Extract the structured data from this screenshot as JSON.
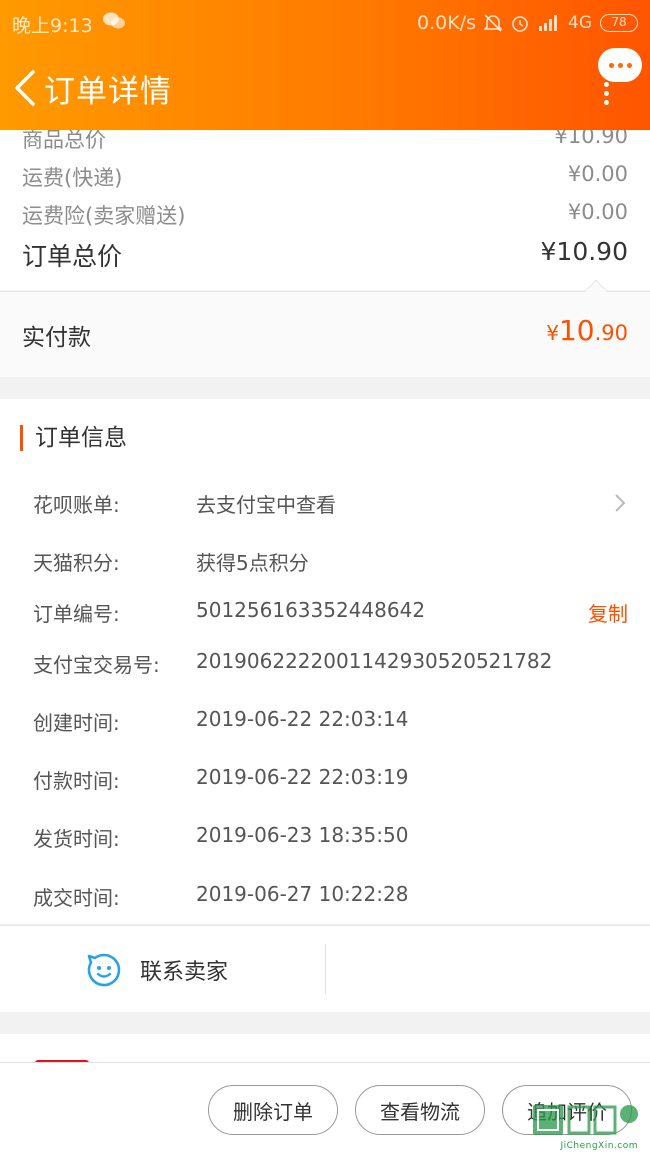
{
  "status_bar": {
    "time": "晚上9:13",
    "network_speed": "0.0K/s",
    "network_type": "4G",
    "battery": "78"
  },
  "header": {
    "title": "订单详情"
  },
  "price_summary": {
    "partial_row": {
      "label": "商品总价",
      "value": "¥10.90"
    },
    "rows": [
      {
        "label": "运费(快递)",
        "value": "¥0.00"
      },
      {
        "label": "运费险(卖家赠送)",
        "value": "¥0.00"
      }
    ],
    "total": {
      "label": "订单总价",
      "value": "¥10.90"
    },
    "paid": {
      "label": "实付款",
      "currency": "¥",
      "integer": "10",
      "decimal": ".90"
    }
  },
  "order_info": {
    "title": "订单信息",
    "huabei": {
      "label": "花呗账单:",
      "value": "去支付宝中查看"
    },
    "tmall_points": {
      "label": "天猫积分:",
      "value": "获得5点积分"
    },
    "order_number": {
      "label": "订单编号:",
      "value": "501256163352448642",
      "copy_label": "复制"
    },
    "alipay_tx": {
      "label": "支付宝交易号:",
      "value": "2019062222001142930520521782"
    },
    "times": [
      {
        "label": "创建时间:",
        "value": "2019-06-22 22:03:14"
      },
      {
        "label": "付款时间:",
        "value": "2019-06-22 22:03:19"
      },
      {
        "label": "发货时间:",
        "value": "2019-06-23 18:35:50"
      },
      {
        "label": "成交时间:",
        "value": "2019-06-27 10:22:28"
      }
    ]
  },
  "contact": {
    "label": "联系卖家"
  },
  "actions": {
    "delete": "删除订单",
    "logistics": "查看物流",
    "review": "追加评价"
  },
  "watermark": {
    "text": "JiChengXin.com"
  },
  "colors": {
    "accent": "#ff5000",
    "header_start": "#ff9a00",
    "header_end": "#ff5500"
  }
}
